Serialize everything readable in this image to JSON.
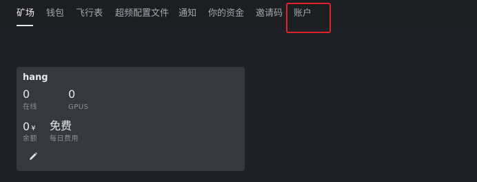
{
  "nav": {
    "items": [
      "矿场",
      "钱包",
      "飞行表",
      "超频配置文件",
      "通知",
      "你的资金",
      "邀请码",
      "账户"
    ],
    "active_index": 0,
    "highlighted_index": 7
  },
  "rig_card": {
    "name": "hang",
    "online": {
      "value": "0",
      "label": "在线"
    },
    "gpus": {
      "value": "0",
      "label": "GPUS"
    },
    "balance": {
      "value": "0",
      "currency": "¥",
      "label": "余额"
    },
    "daily_fee": {
      "value": "免费",
      "label": "每日费用"
    },
    "edit_icon": "pencil-icon"
  },
  "colors": {
    "background": "#1f2126",
    "nav_background": "#1c1e22",
    "card_background": "#35383e",
    "highlight": "#e0232a"
  }
}
